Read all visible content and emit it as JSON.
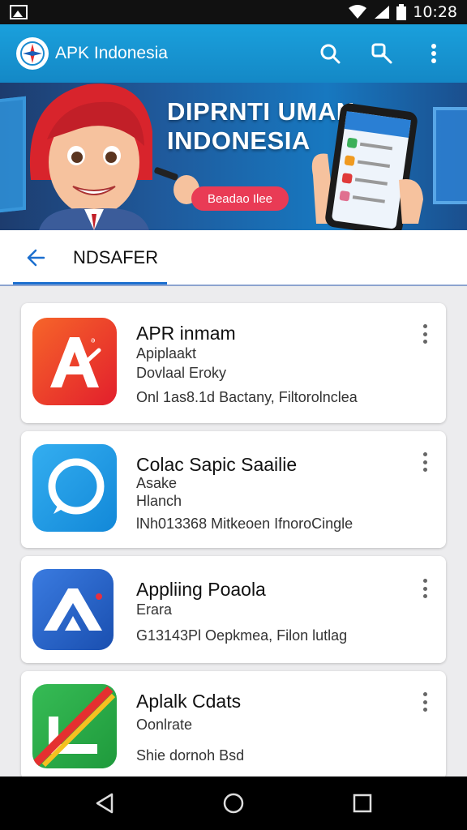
{
  "status_bar": {
    "time": "10:28",
    "icons": [
      "image-icon",
      "wifi-icon",
      "signal-icon",
      "battery-icon"
    ]
  },
  "app_bar": {
    "title": "APK Indonesia",
    "icons": [
      "search-icon",
      "search-settings-icon",
      "more-vertical-icon"
    ]
  },
  "banner": {
    "title_line1": "DIPRNTI UMAN",
    "title_line2": "INDONESIA",
    "cta": "Beadao Ilee"
  },
  "sub_header": {
    "title": "NDSAFER"
  },
  "apps": [
    {
      "title": "APR inmam",
      "line1": "Apiplaakt",
      "line2": "Dovlaal Eroky",
      "line3": "Onl 1as8.1d Bactany, Filtorolnclea",
      "icon_colors": [
        "#f25a22",
        "#e51e2a"
      ]
    },
    {
      "title": "Colac Sapic Saailie",
      "line1": "Asake",
      "line2": "Hlanch",
      "line3": "lNh013368 Mitkeoen IfnoroCingle",
      "icon_colors": [
        "#2aa5ea",
        "#1288d8"
      ]
    },
    {
      "title": "Appliing Poaola",
      "line1": "Erara",
      "line2": "",
      "line3": "G13143Pl Oepkmea, Filon lutlag",
      "icon_colors": [
        "#2f6fd6",
        "#1a4fb0"
      ]
    },
    {
      "title": "Aplalk Cdats",
      "line1": "Oonlrate",
      "line2": "",
      "line3": "Shie dornoh Bsd",
      "icon_colors": [
        "#2db34e",
        "#1f9a3c"
      ]
    }
  ],
  "colors": {
    "app_bar": "#1aa0dc",
    "accent": "#1c6fcf",
    "cta": "#e93b55"
  }
}
